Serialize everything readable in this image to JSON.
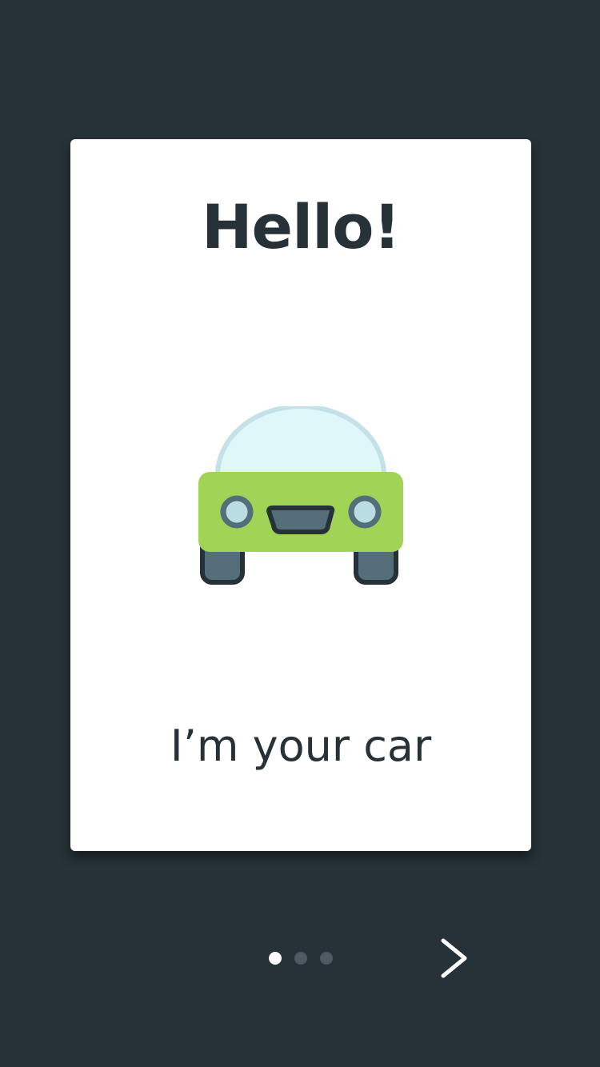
{
  "onboarding": {
    "title": "Hello!",
    "subtitle": "I’m your car",
    "illustration": "car-icon"
  },
  "pager": {
    "total": 3,
    "active_index": 0
  },
  "controls": {
    "next_icon": "chevron-right-icon"
  },
  "colors": {
    "background": "#263238",
    "card": "#ffffff",
    "text": "#263238",
    "car_body": "#a1d456",
    "windshield": "#e0f7fa",
    "windshield_stroke": "#c5e1e8",
    "headlight": "#b9dde3",
    "trim": "#546e7a",
    "dot_active": "#ffffff",
    "dot_inactive": "#4f5b62"
  }
}
